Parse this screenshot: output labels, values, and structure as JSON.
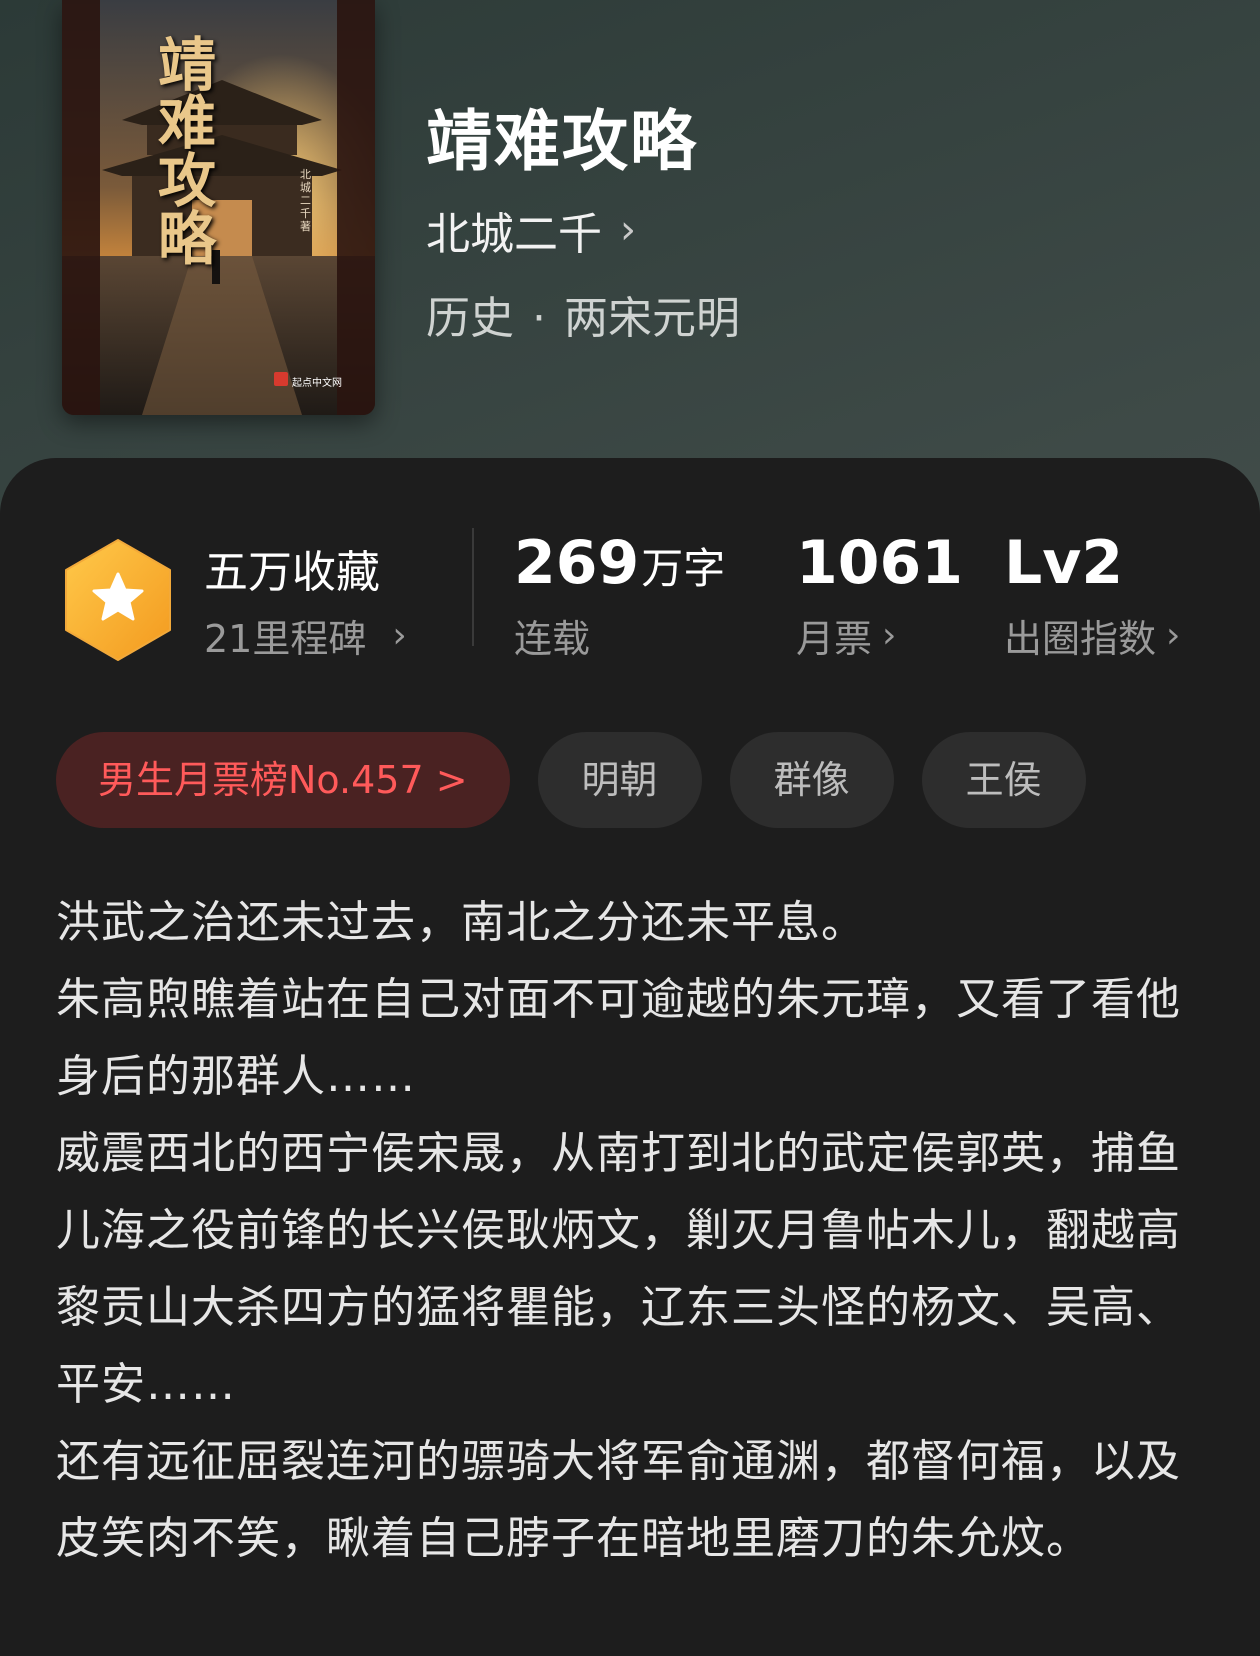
{
  "book": {
    "title": "靖难攻略",
    "author": "北城二千",
    "category": "历史",
    "subcategory": "两宋元明",
    "cover": {
      "title_text": "靖难攻略",
      "author_text": "北城二千著",
      "publisher_mark": "起点中文网"
    }
  },
  "stats": {
    "collection": {
      "title": "五万收藏",
      "subtitle": "21里程碑"
    },
    "words": {
      "value": "269",
      "unit": "万字",
      "label": "连载"
    },
    "monthly_tickets": {
      "value": "1061",
      "label": "月票"
    },
    "popularity": {
      "value": "Lv2",
      "label": "出圈指数"
    }
  },
  "tags": {
    "rank": "男生月票榜No.457 >",
    "items": [
      "明朝",
      "群像",
      "王侯"
    ]
  },
  "synopsis": [
    "洪武之治还未过去，南北之分还未平息。",
    "朱高煦瞧着站在自己对面不可逾越的朱元璋，又看了看他身后的那群人……",
    "威震西北的西宁侯宋晟，从南打到北的武定侯郭英，捕鱼儿海之役前锋的长兴侯耿炳文，剿灭月鲁帖木儿，翻越高黎贡山大杀四方的猛将瞿能，辽东三头怪的杨文、吴高、平安……",
    "还有远征屈裂连河的骠骑大将军俞通渊，都督何福，以及皮笑肉不笑，瞅着自己脖子在暗地里磨刀的朱允炆。"
  ],
  "colors": {
    "accent_red": "#ff5a5a",
    "badge_gold": "#f7b733",
    "card_bg": "#1d1d1d"
  },
  "icons": {
    "badge": "star-hexagon-icon",
    "chevron": "chevron-right-icon"
  }
}
